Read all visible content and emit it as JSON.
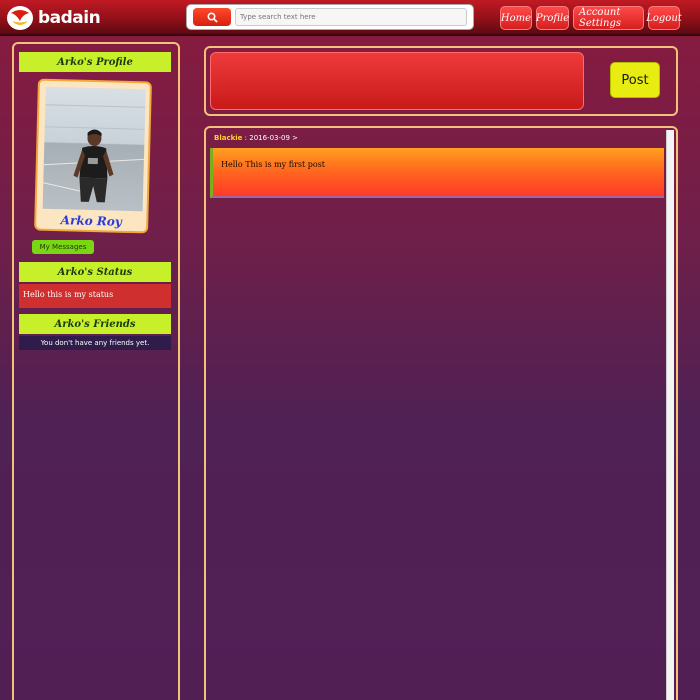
{
  "app": {
    "brand": "badain"
  },
  "search": {
    "placeholder": "Type search text here"
  },
  "nav": {
    "items": [
      "Home",
      "Profile",
      "Account Settings",
      "Logout"
    ]
  },
  "sidebar": {
    "profile_header": "Arko's Profile",
    "profile_name": "Arko Roy",
    "messages_button": "My Messages",
    "status_header": "Arko's Status",
    "status_text": "Hello this is my status",
    "friends_header": "Arko's Friends",
    "friends_empty": "You don't have any friends yet."
  },
  "composer": {
    "post_button": "Post"
  },
  "feed": {
    "posts": [
      {
        "author": "Blackie",
        "date": "2016-03-09",
        "separator": ":",
        "arrow": ">",
        "text": "Hello This is my first post"
      }
    ]
  },
  "colors": {
    "accent_green": "#c8f02a",
    "topbar_red": "#c01a24",
    "post_yellow": "#e8ec10"
  }
}
